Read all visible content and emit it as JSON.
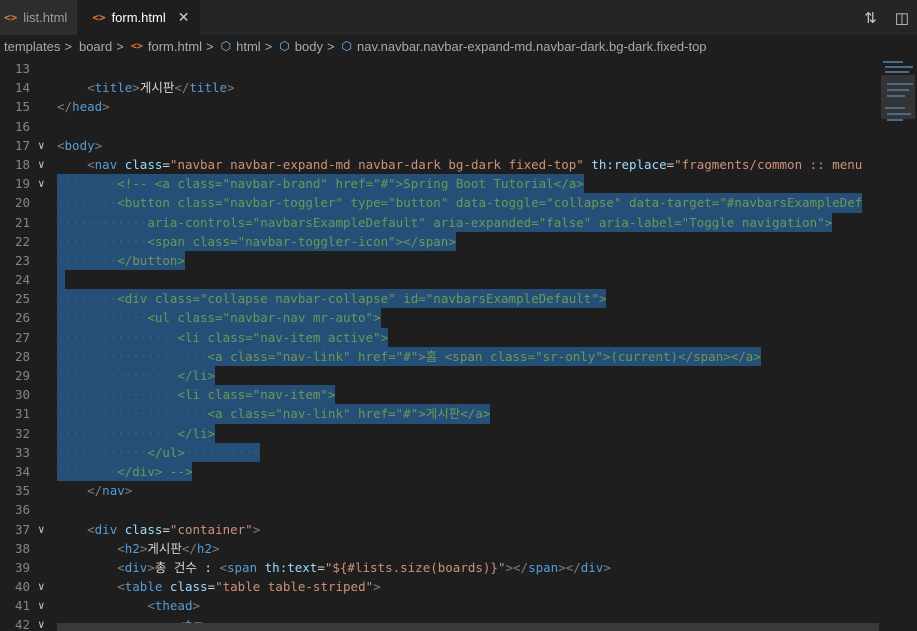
{
  "tabs": [
    {
      "icon": "<>",
      "label": "list.html",
      "active": false
    },
    {
      "icon": "<>",
      "label": "form.html",
      "active": true,
      "close": "✕"
    }
  ],
  "breadcrumb": {
    "templates": "templates",
    "board": "board",
    "file": "form.html",
    "html": "html",
    "body": "body",
    "nav": "nav.navbar.navbar-expand-md.navbar-dark.bg-dark.fixed-top",
    "sep": ">"
  },
  "colors": {
    "background": "#1e1e1e",
    "selection": "#264f78",
    "tag": "#569cd6",
    "attr": "#9cdcfe",
    "string": "#ce9178",
    "bracket": "#808080"
  },
  "lines": [
    {
      "num": "13",
      "fold": "",
      "sel": "none",
      "tokens": []
    },
    {
      "num": "14",
      "fold": "",
      "sel": "none",
      "tokens": [
        [
          "ind",
          "    "
        ],
        [
          "tg",
          "<"
        ],
        [
          "tn",
          "title"
        ],
        [
          "tg",
          ">"
        ],
        [
          "tx",
          "게시판"
        ],
        [
          "tg",
          "</"
        ],
        [
          "tn",
          "title"
        ],
        [
          "tg",
          ">"
        ]
      ]
    },
    {
      "num": "15",
      "fold": "",
      "sel": "none",
      "tokens": [
        [
          "tg",
          "</"
        ],
        [
          "tn",
          "head"
        ],
        [
          "tg",
          ">"
        ]
      ]
    },
    {
      "num": "16",
      "fold": "",
      "sel": "none",
      "tokens": []
    },
    {
      "num": "17",
      "fold": "∨",
      "sel": "none",
      "tokens": [
        [
          "tg",
          "<"
        ],
        [
          "tn",
          "body"
        ],
        [
          "tg",
          ">"
        ]
      ]
    },
    {
      "num": "18",
      "fold": "∨",
      "sel": "none",
      "tokens": [
        [
          "ind",
          "    "
        ],
        [
          "tg",
          "<"
        ],
        [
          "tn",
          "nav"
        ],
        [
          "tx",
          " "
        ],
        [
          "at",
          "class"
        ],
        [
          "tx",
          "="
        ],
        [
          "av",
          "\"navbar navbar-expand-md navbar-dark bg-dark fixed-top\""
        ],
        [
          "tx",
          " "
        ],
        [
          "at",
          "th:replace"
        ],
        [
          "tx",
          "="
        ],
        [
          "av",
          "\"fragments/common :: menu"
        ]
      ]
    },
    {
      "num": "19",
      "fold": "∨",
      "sel": "full",
      "tokens": [
        [
          "ind",
          "········"
        ],
        [
          "cm",
          "<!-- <a class=\"navbar-brand\" href=\"#\">Spring Boot Tutorial</a>"
        ]
      ]
    },
    {
      "num": "20",
      "fold": "",
      "sel": "full",
      "tokens": [
        [
          "ind",
          "········"
        ],
        [
          "cm",
          "<button class=\"navbar-toggler\" type=\"button\" data-toggle=\"collapse\" data-target=\"#navbarsExampleDef"
        ]
      ]
    },
    {
      "num": "21",
      "fold": "",
      "sel": "full",
      "tokens": [
        [
          "ind",
          "············"
        ],
        [
          "cm",
          "aria-controls=\"navbarsExampleDefault\" aria-expanded=\"false\" aria-label=\"Toggle navigation\">"
        ]
      ]
    },
    {
      "num": "22",
      "fold": "",
      "sel": "full",
      "tokens": [
        [
          "ind",
          "············"
        ],
        [
          "cm",
          "<span class=\"navbar-toggler-icon\"></span>"
        ]
      ]
    },
    {
      "num": "23",
      "fold": "",
      "sel": "full",
      "tokens": [
        [
          "ind",
          "········"
        ],
        [
          "cm",
          "</button>"
        ]
      ]
    },
    {
      "num": "24",
      "fold": "",
      "sel": "full",
      "tokens": [
        [
          "ind",
          " "
        ]
      ]
    },
    {
      "num": "25",
      "fold": "",
      "sel": "full",
      "tokens": [
        [
          "ind",
          "········"
        ],
        [
          "cm",
          "<div class=\"collapse navbar-collapse\" id=\"navbarsExampleDefault\">"
        ]
      ]
    },
    {
      "num": "26",
      "fold": "",
      "sel": "full",
      "tokens": [
        [
          "ind",
          "············"
        ],
        [
          "cm",
          "<ul class=\"navbar-nav mr-auto\">"
        ]
      ]
    },
    {
      "num": "27",
      "fold": "",
      "sel": "full",
      "tokens": [
        [
          "ind",
          "················"
        ],
        [
          "cm",
          "<li class=\"nav-item active\">"
        ]
      ]
    },
    {
      "num": "28",
      "fold": "",
      "sel": "full",
      "tokens": [
        [
          "ind",
          "····················"
        ],
        [
          "cm",
          "<a class=\"nav-link\" href=\"#\">홈 <span class=\"sr-only\">(current)</span></a>"
        ]
      ]
    },
    {
      "num": "29",
      "fold": "",
      "sel": "full",
      "tokens": [
        [
          "ind",
          "················"
        ],
        [
          "cm",
          "</li>"
        ]
      ]
    },
    {
      "num": "30",
      "fold": "",
      "sel": "full",
      "tokens": [
        [
          "ind",
          "················"
        ],
        [
          "cm",
          "<li class=\"nav-item\">"
        ]
      ]
    },
    {
      "num": "31",
      "fold": "",
      "sel": "full",
      "tokens": [
        [
          "ind",
          "····················"
        ],
        [
          "cm",
          "<a class=\"nav-link\" href=\"#\">게시판</a>"
        ]
      ]
    },
    {
      "num": "32",
      "fold": "",
      "sel": "full",
      "tokens": [
        [
          "ind",
          "················"
        ],
        [
          "cm",
          "</li>"
        ]
      ]
    },
    {
      "num": "33",
      "fold": "",
      "sel": "full",
      "tokens": [
        [
          "ind",
          "············"
        ],
        [
          "cm",
          "</ul>"
        ],
        [
          "ind",
          "··········"
        ]
      ]
    },
    {
      "num": "34",
      "fold": "",
      "sel": "full",
      "tokens": [
        [
          "ind",
          "········"
        ],
        [
          "cm",
          "</div> -->"
        ]
      ]
    },
    {
      "num": "35",
      "fold": "",
      "sel": "none",
      "tokens": [
        [
          "ind",
          "    "
        ],
        [
          "tg",
          "</"
        ],
        [
          "tn",
          "nav"
        ],
        [
          "tg",
          ">"
        ]
      ]
    },
    {
      "num": "36",
      "fold": "",
      "sel": "none",
      "tokens": []
    },
    {
      "num": "37",
      "fold": "∨",
      "sel": "none",
      "tokens": [
        [
          "ind",
          "    "
        ],
        [
          "tg",
          "<"
        ],
        [
          "tn",
          "div"
        ],
        [
          "tx",
          " "
        ],
        [
          "at",
          "class"
        ],
        [
          "tx",
          "="
        ],
        [
          "av",
          "\"container\""
        ],
        [
          "tg",
          ">"
        ]
      ]
    },
    {
      "num": "38",
      "fold": "",
      "sel": "none",
      "tokens": [
        [
          "ind",
          "        "
        ],
        [
          "tg",
          "<"
        ],
        [
          "tn",
          "h2"
        ],
        [
          "tg",
          ">"
        ],
        [
          "tx",
          "게시판"
        ],
        [
          "tg",
          "</"
        ],
        [
          "tn",
          "h2"
        ],
        [
          "tg",
          ">"
        ]
      ]
    },
    {
      "num": "39",
      "fold": "",
      "sel": "none",
      "tokens": [
        [
          "ind",
          "        "
        ],
        [
          "tg",
          "<"
        ],
        [
          "tn",
          "div"
        ],
        [
          "tg",
          ">"
        ],
        [
          "tx",
          "총 건수 : "
        ],
        [
          "tg",
          "<"
        ],
        [
          "tn",
          "span"
        ],
        [
          "tx",
          " "
        ],
        [
          "at",
          "th:text"
        ],
        [
          "tx",
          "="
        ],
        [
          "av",
          "\"${#lists.size(boards)}\""
        ],
        [
          "tg",
          "></"
        ],
        [
          "tn",
          "span"
        ],
        [
          "tg",
          "></"
        ],
        [
          "tn",
          "div"
        ],
        [
          "tg",
          ">"
        ]
      ]
    },
    {
      "num": "40",
      "fold": "∨",
      "sel": "none",
      "tokens": [
        [
          "ind",
          "        "
        ],
        [
          "tg",
          "<"
        ],
        [
          "tn",
          "table"
        ],
        [
          "tx",
          " "
        ],
        [
          "at",
          "class"
        ],
        [
          "tx",
          "="
        ],
        [
          "av",
          "\"table table-striped\""
        ],
        [
          "tg",
          ">"
        ]
      ]
    },
    {
      "num": "41",
      "fold": "∨",
      "sel": "none",
      "tokens": [
        [
          "ind",
          "            "
        ],
        [
          "tg",
          "<"
        ],
        [
          "tn",
          "thead"
        ],
        [
          "tg",
          ">"
        ]
      ]
    },
    {
      "num": "42",
      "fold": "∨",
      "sel": "none",
      "tokens": [
        [
          "ind",
          "                "
        ],
        [
          "tg",
          "<"
        ],
        [
          "tn",
          "tr"
        ],
        [
          "tg",
          ">"
        ]
      ]
    }
  ]
}
